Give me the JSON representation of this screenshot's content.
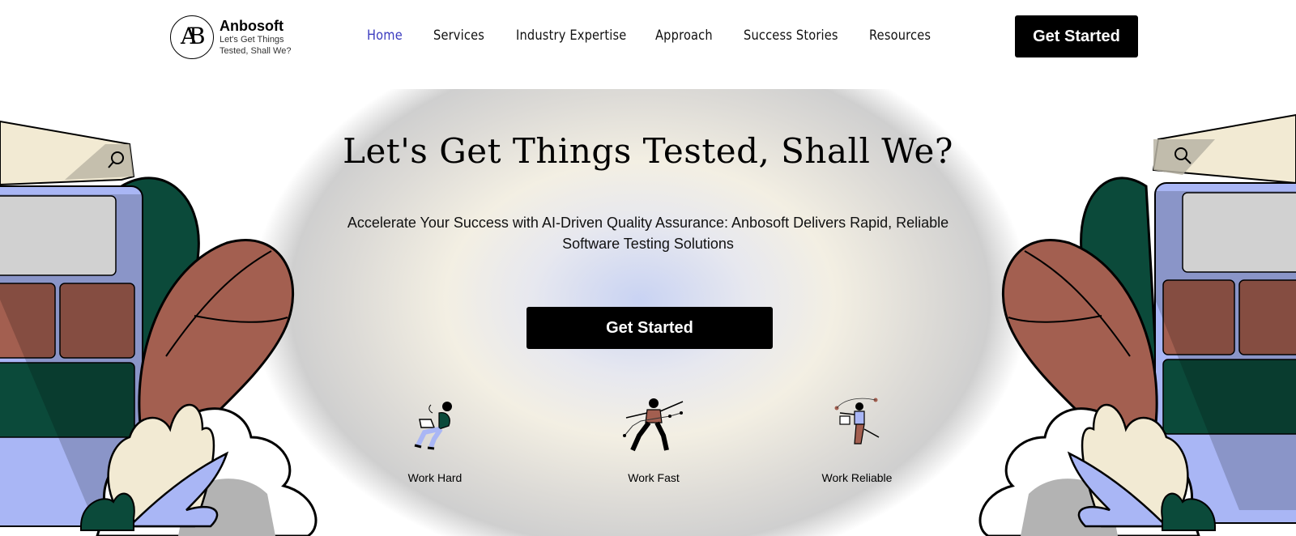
{
  "brand": {
    "logo_letters": "AB",
    "name": "Anbosoft",
    "tagline": "Let's Get Things Tested, Shall We?"
  },
  "nav": {
    "items": [
      {
        "label": "Home",
        "active": true
      },
      {
        "label": "Services"
      },
      {
        "label": "Industry Expertise"
      },
      {
        "label": "Approach"
      },
      {
        "label": "Success Stories"
      },
      {
        "label": "Resources"
      }
    ]
  },
  "header": {
    "cta_label": "Get Started"
  },
  "hero": {
    "title": "Let's Get Things Tested, Shall We?",
    "subtitle": "Accelerate Your Success with AI-Driven Quality Assurance: Anbosoft Delivers Rapid, Reliable Software Testing Solutions",
    "cta_label": "Get Started"
  },
  "features": [
    {
      "label": "Work Hard",
      "icon": "person-with-laptop-icon"
    },
    {
      "label": "Work Fast",
      "icon": "person-running-icon"
    },
    {
      "label": "Work Reliable",
      "icon": "person-juggling-icon"
    }
  ],
  "colors": {
    "accent_nav": "#3b3bbf",
    "button": "#000000",
    "leaf_green": "#0b4a3a",
    "leaf_brown": "#a35f50",
    "periwinkle": "#a9b6f5",
    "cream": "#f2ead3"
  }
}
